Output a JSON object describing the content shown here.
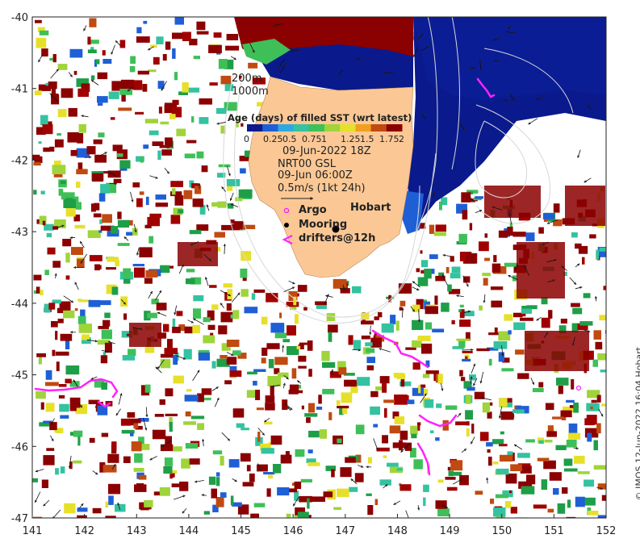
{
  "map": {
    "x_ticks": [
      "141",
      "142",
      "143",
      "144",
      "145",
      "146",
      "147",
      "148",
      "149",
      "150",
      "151",
      "152"
    ],
    "y_ticks": [
      "-40",
      "-41",
      "-42",
      "-43",
      "-44",
      "-45",
      "-46",
      "-47"
    ],
    "lon_range": [
      141,
      152
    ],
    "lat_range": [
      -47,
      -40
    ],
    "colors": {
      "land": "#fbc895",
      "frame": "#222222"
    }
  },
  "legend": {
    "isobath_200": "200m",
    "isobath_1000": "1000m",
    "colorbar_title": "Age (days) of filled SST (wrt latest)",
    "colorbar_ticks": [
      "0",
      "0.25",
      "0.5",
      "0.75",
      "1",
      "1.25",
      "1.5",
      "1.75",
      "2"
    ],
    "colorbar_colors": [
      "#0a1a8c",
      "#1f5fd6",
      "#2fa8e0",
      "#34c2a0",
      "#3fbf58",
      "#9fd43a",
      "#e6e02a",
      "#f0a020",
      "#c04a10",
      "#8b0000"
    ],
    "date": "09-Jun-2022 18Z",
    "product": "NRT00 GSL",
    "time": "09-Jun 06:00Z",
    "scale": "0.5m/s (1kt 24h)",
    "argo": "Argo",
    "mooring": "Mooring",
    "drifters": "drifters@12h"
  },
  "places": {
    "hobart": "Hobart"
  },
  "credit": "© IMOS 12-Jun-2022 16:04 Hobart"
}
